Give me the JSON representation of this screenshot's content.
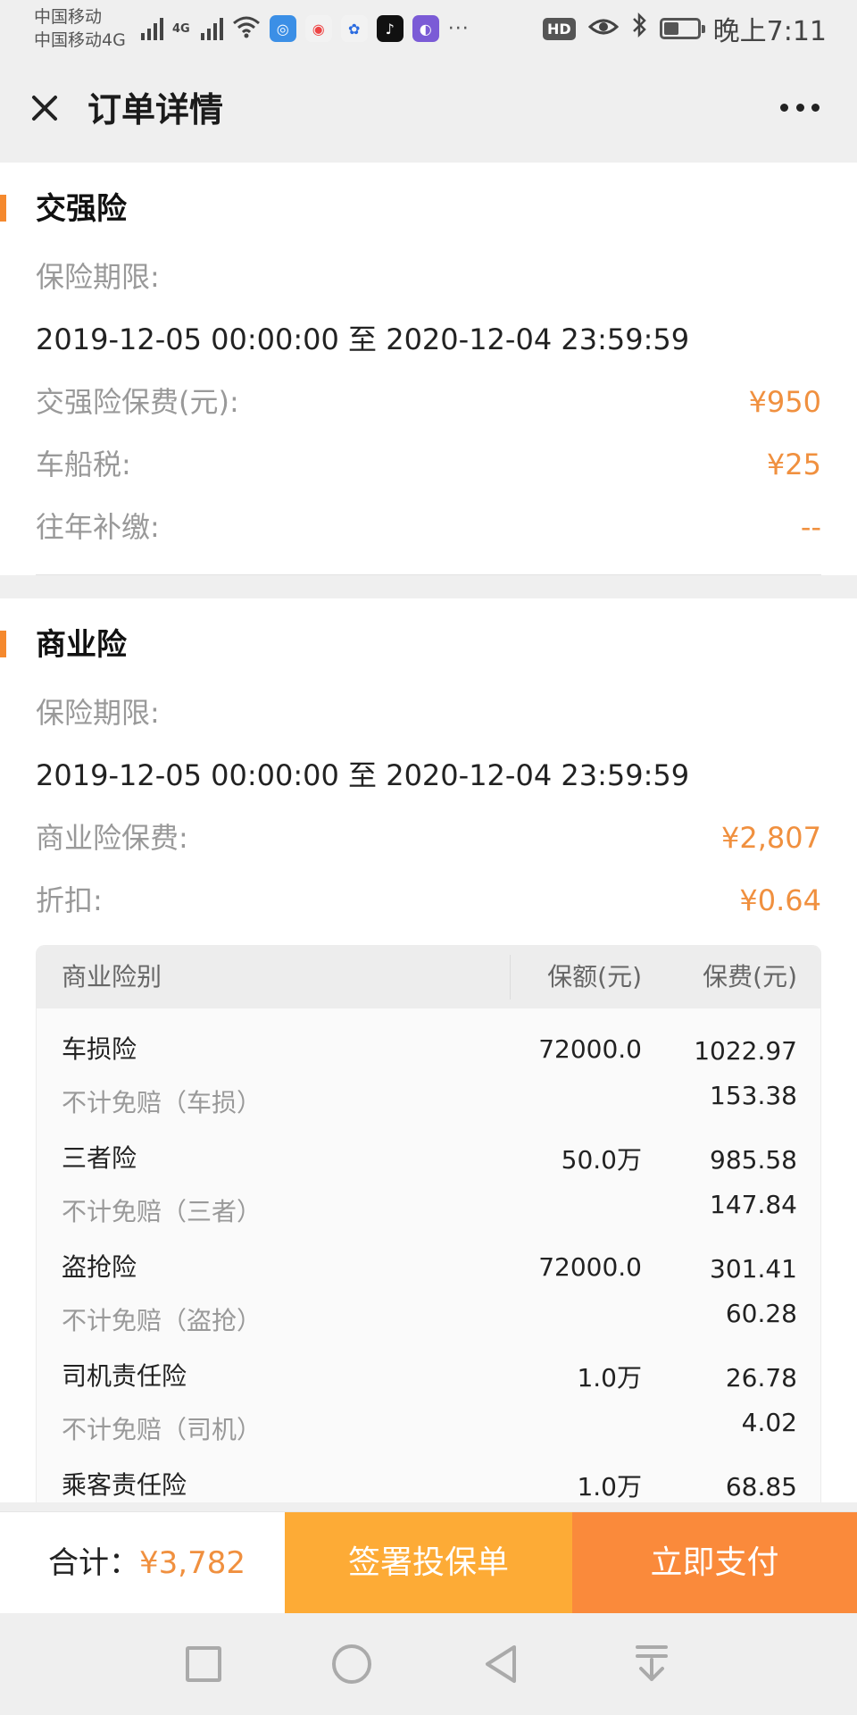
{
  "status_bar": {
    "carrier_line1": "中国移动",
    "carrier_line2": "中国移动4G",
    "time": "晚上7:11",
    "hd": "HD",
    "more": "···",
    "battery_level": 0.45
  },
  "header": {
    "title": "订单详情"
  },
  "compulsory": {
    "title": "交强险",
    "period_label": "保险期限:",
    "period": "2019-12-05 00:00:00 至 2020-12-04 23:59:59",
    "rows": [
      {
        "label": "交强险保费(元):",
        "value": "¥950"
      },
      {
        "label": "车船税:",
        "value": "¥25"
      },
      {
        "label": "往年补缴:",
        "value": "--"
      }
    ]
  },
  "commercial": {
    "title": "商业险",
    "period_label": "保险期限:",
    "period": "2019-12-05 00:00:00 至 2020-12-04 23:59:59",
    "rows": [
      {
        "label": "商业险保费:",
        "value": "¥2,807"
      },
      {
        "label": "折扣:",
        "value": "¥0.64"
      }
    ],
    "table": {
      "headers": [
        "商业险别",
        "保额(元)",
        "保费(元)"
      ],
      "rows": [
        {
          "name": "车损险",
          "amount": "72000.0",
          "premium": "1022.97"
        },
        {
          "name": "不计免赔（车损）",
          "amount": "",
          "premium": "153.38"
        },
        {
          "name": "三者险",
          "amount": "50.0万",
          "premium": "985.58"
        },
        {
          "name": "不计免赔（三者）",
          "amount": "",
          "premium": "147.84"
        },
        {
          "name": "盗抢险",
          "amount": "72000.0",
          "premium": "301.41"
        },
        {
          "name": "不计免赔（盗抢）",
          "amount": "",
          "premium": "60.28"
        },
        {
          "name": "司机责任险",
          "amount": "1.0万",
          "premium": "26.78"
        },
        {
          "name": "不计免赔（司机）",
          "amount": "",
          "premium": "4.02"
        },
        {
          "name": "乘客责任险",
          "amount": "1.0万",
          "premium": "68.85"
        }
      ]
    }
  },
  "footer": {
    "total_label": "合计：",
    "total_value": "¥3,782",
    "sign_button": "签署投保单",
    "pay_button": "立即支付"
  },
  "colors": {
    "accent": "#f5892e",
    "price": "#f0903f",
    "sign_button": "#fdab36",
    "pay_button": "#fa8a3b"
  }
}
